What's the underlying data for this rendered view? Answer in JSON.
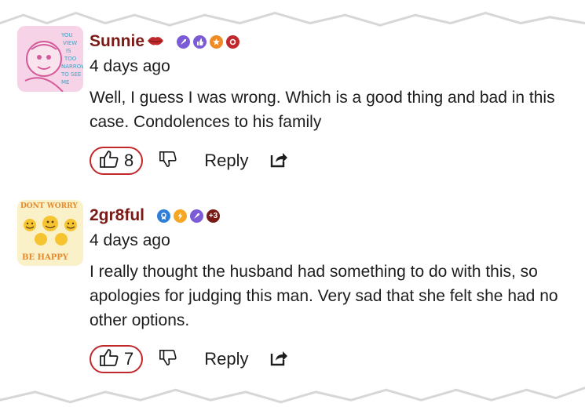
{
  "comments": [
    {
      "username": "Sunnie",
      "timestamp": "4 days ago",
      "text": "Well, I guess I was wrong. Which is a good thing and bad in this case. Condolences to his family",
      "likes": "8",
      "reply_label": "Reply",
      "badges": [
        "rocket-icon",
        "thumbs-up-icon",
        "star-icon",
        "heart-icon"
      ],
      "badge_colors": [
        "#7b5bd6",
        "#7b5bd6",
        "#f08a24",
        "#c0282b"
      ]
    },
    {
      "username": "2gr8ful",
      "timestamp": "4 days ago",
      "text": "I really thought the husband had something to do with this, so apologies for judging this man. Very sad that she felt she had no other options.",
      "likes": "7",
      "reply_label": "Reply",
      "badges": [
        "award-icon",
        "lightning-icon",
        "rocket-icon",
        "plus-three"
      ],
      "badge_colors": [
        "#2f7fd8",
        "#f5a623",
        "#7b5bd6",
        "#7a1a16"
      ],
      "more_badges_label": "+3"
    }
  ],
  "colors": {
    "username": "#7a1a16",
    "like_border": "#c0282b",
    "text": "#1d1d1d"
  }
}
